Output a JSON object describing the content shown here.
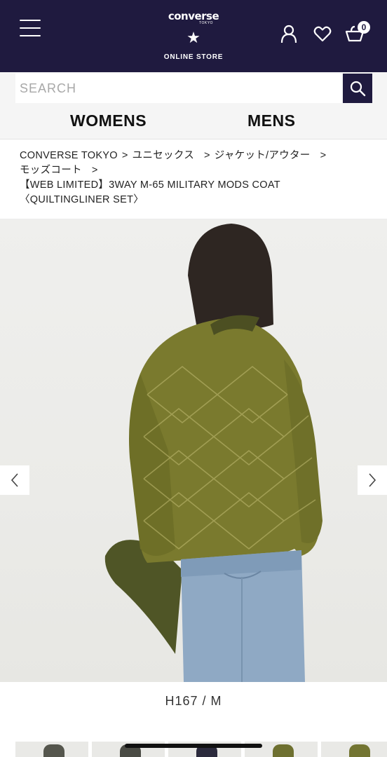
{
  "header": {
    "brand": "converse",
    "brand_sub": "TOKYO",
    "store_label": "ONLINE STORE",
    "cart_count": "0",
    "icons": {
      "menu": "hamburger-menu-icon",
      "account": "user-icon",
      "favorites": "heart-icon",
      "cart": "cart-icon",
      "logo_mark": "star-icon"
    },
    "colors": {
      "background": "#1f1a3f",
      "foreground": "#ffffff"
    }
  },
  "search": {
    "placeholder": "SEARCH",
    "value": "",
    "button_icon": "search-icon"
  },
  "gender_nav": {
    "tabs": [
      {
        "label": "WOMENS"
      },
      {
        "label": "MENS"
      }
    ]
  },
  "breadcrumb": {
    "items": [
      {
        "label": "CONVERSE TOKYO"
      },
      {
        "label": "ユニセックス"
      },
      {
        "label": "ジャケット/アウター"
      },
      {
        "label": "モッズコート"
      }
    ],
    "separator": ">",
    "current": "【WEB LIMITED】3WAY M-65 MILITARY MODS COAT 〈QUILTINGLINER SET〉"
  },
  "product": {
    "model_caption": "H167 / M",
    "image_icons": {
      "prev": "chevron-left-icon",
      "next": "chevron-right-icon"
    },
    "jacket_color": "#7a7a2e"
  },
  "thumbnails": {
    "count_visible": 5
  }
}
